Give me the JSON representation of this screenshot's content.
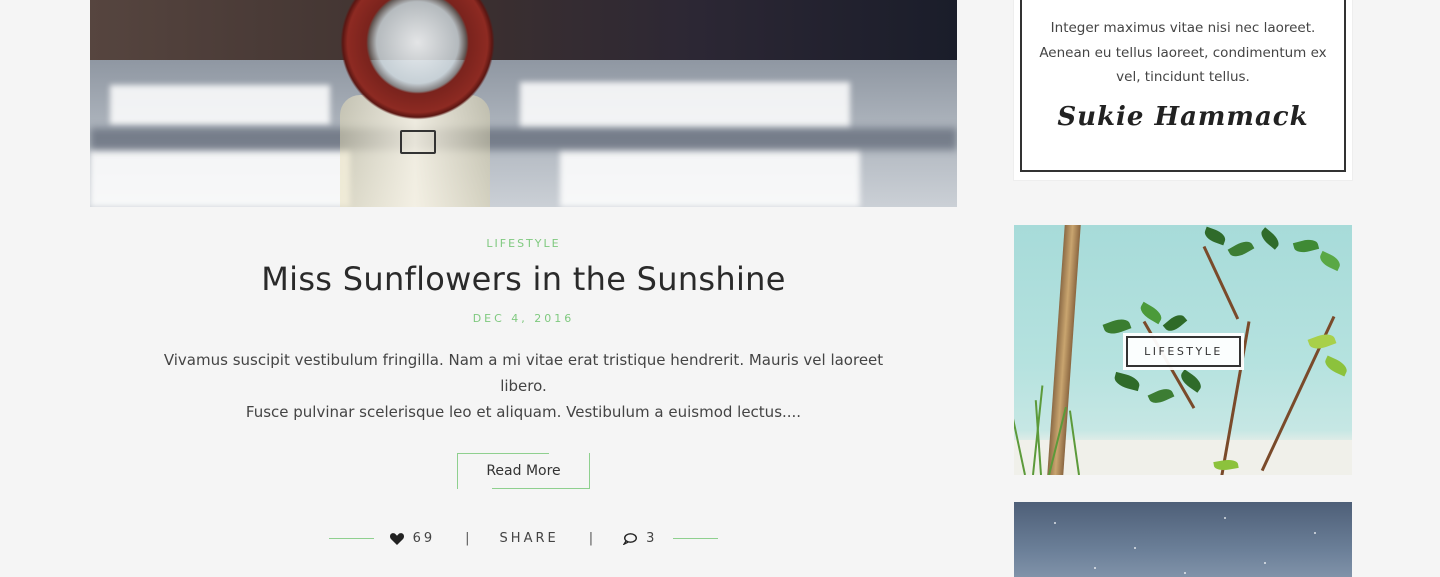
{
  "post": {
    "category": "LIFESTYLE",
    "title": "Miss Sunflowers in the Sunshine",
    "date": "DEC 4, 2016",
    "excerpt_line1": "Vivamus suscipit vestibulum fringilla. Nam a mi vitae erat tristique hendrerit. Mauris vel laoreet libero.",
    "excerpt_line2": "Fusce pulvinar scelerisque leo et aliquam. Vestibulum a euismod lectus....",
    "read_more_label": "Read More",
    "likes": "69",
    "share_label": "SHARE",
    "comments": "3",
    "separator": "|",
    "accent_color": "#7fc97f"
  },
  "sidebar": {
    "about": {
      "text_line1": "Integer maximus vitae nisi nec laoreet.",
      "text_line2": "Aenean eu tellus laoreet, condimentum ex",
      "text_line3": "vel, tincidunt tellus.",
      "signature": "Sukie Hammack"
    },
    "feature": {
      "label": "LIFESTYLE"
    }
  },
  "icons": {
    "likes": "heart-icon",
    "comments": "comment-icon"
  }
}
